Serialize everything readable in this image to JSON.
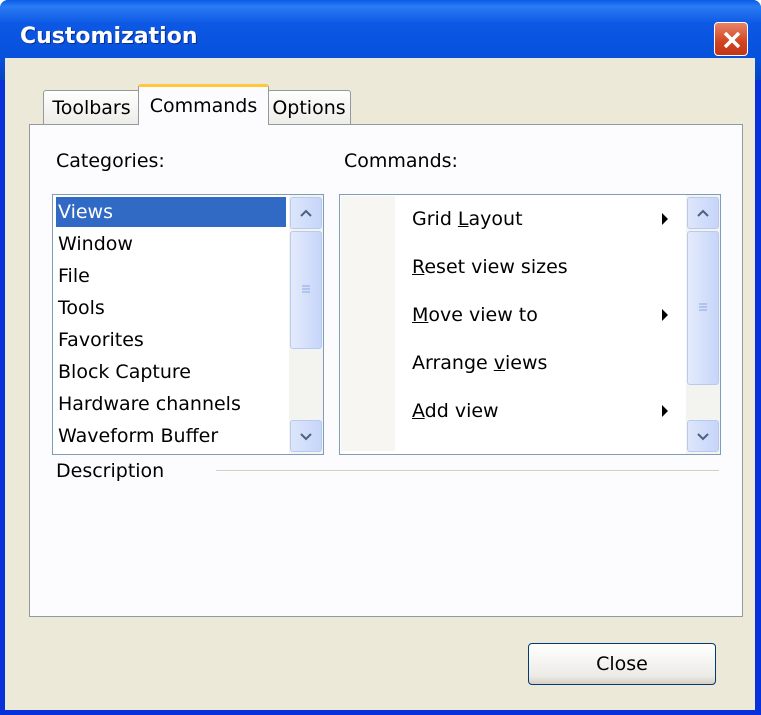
{
  "window": {
    "title": "Customization"
  },
  "tabs": [
    {
      "label": "Toolbars",
      "active": false
    },
    {
      "label": "Commands",
      "active": true
    },
    {
      "label": "Options",
      "active": false
    }
  ],
  "categories": {
    "label": "Categories:",
    "items": [
      "Views",
      "Window",
      "File",
      "Tools",
      "Favorites",
      "Block Capture",
      "Hardware channels",
      "Waveform Buffer"
    ],
    "selected": "Views"
  },
  "commands": {
    "label": "Commands:",
    "items": [
      {
        "pre": "Grid ",
        "u": "L",
        "post": "ayout",
        "submenu": true
      },
      {
        "pre": "",
        "u": "R",
        "post": "eset view sizes",
        "submenu": false
      },
      {
        "pre": "",
        "u": "M",
        "post": "ove view to",
        "submenu": true
      },
      {
        "pre": "Arrange ",
        "u": "v",
        "post": "iews",
        "submenu": false
      },
      {
        "pre": "",
        "u": "A",
        "post": "dd view",
        "submenu": true
      }
    ]
  },
  "description": {
    "label": "Description"
  },
  "buttons": {
    "close": "Close"
  },
  "colors": {
    "titlebar": "#0752dc",
    "selection": "#316ac5",
    "dialog_bg": "#ece9d8"
  },
  "icons": {
    "close": "close-x-icon",
    "scroll_up": "chevron-up-icon",
    "scroll_down": "chevron-down-icon",
    "submenu": "submenu-arrow-icon"
  }
}
